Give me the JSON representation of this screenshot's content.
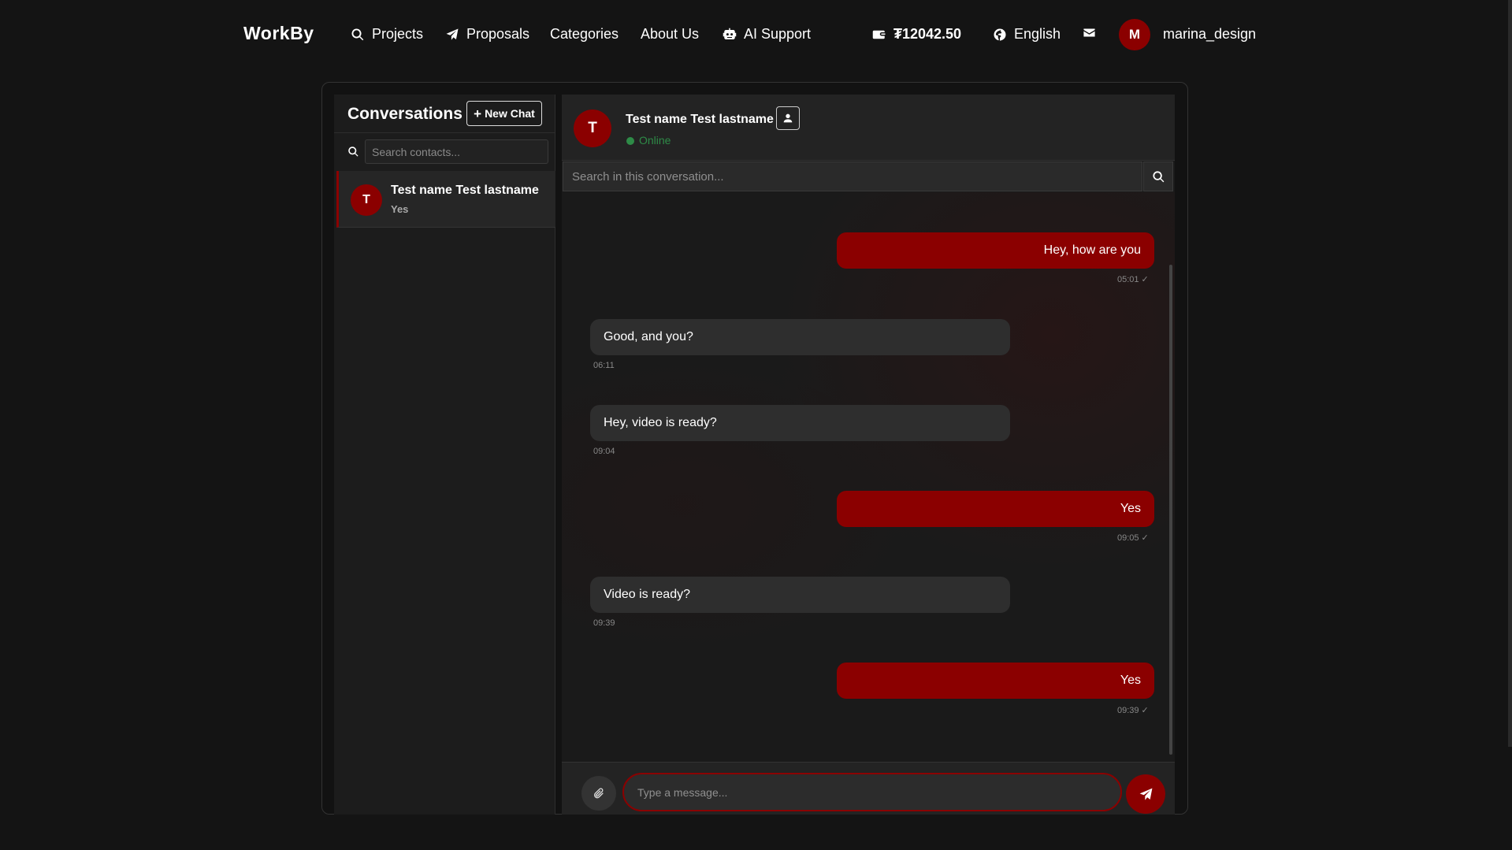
{
  "nav": {
    "brand": "WorkBy",
    "projects": "Projects",
    "proposals": "Proposals",
    "categories": "Categories",
    "about": "About Us",
    "ai_support": "AI Support",
    "balance": "₮12042.50",
    "language": "English",
    "user_initial": "M",
    "username": "marina_design"
  },
  "sidebar": {
    "title": "Conversations",
    "new_chat": "New Chat",
    "search_placeholder": "Search contacts...",
    "contacts": [
      {
        "initial": "T",
        "name": "Test name Test lastname",
        "last_message": "Yes"
      }
    ]
  },
  "chat": {
    "initial": "T",
    "name": "Test name Test lastname",
    "status": "Online",
    "search_placeholder": "Search in this conversation...",
    "messages": [
      {
        "direction": "out",
        "text": "Hey, how are you",
        "time": "05:01"
      },
      {
        "direction": "in",
        "text": "Good, and you?",
        "time": "06:11"
      },
      {
        "direction": "in",
        "text": "Hey, video is ready?",
        "time": "09:04"
      },
      {
        "direction": "out",
        "text": "Yes",
        "time": "09:05"
      },
      {
        "direction": "in",
        "text": "Video is ready?",
        "time": "09:39"
      },
      {
        "direction": "out",
        "text": "Yes",
        "time": "09:39"
      }
    ],
    "composer_placeholder": "Type a message..."
  },
  "colors": {
    "accent": "#8b0000",
    "online": "#2e8b47",
    "background": "#141414"
  }
}
